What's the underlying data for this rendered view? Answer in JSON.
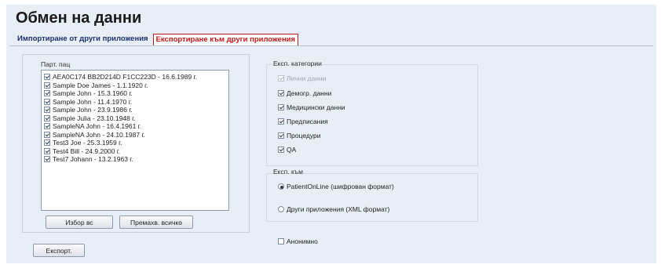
{
  "page_title": "Обмен на данни",
  "tabs": [
    {
      "label": "Импортиране от други приложения",
      "active": false
    },
    {
      "label": "Експортиране към други приложения",
      "active": true
    }
  ],
  "patients": {
    "group_label": "Парт. пац",
    "items": [
      {
        "label": "AEA0C174 BB2D214D F1CC223D - 16.6.1989 г.",
        "checked": true
      },
      {
        "label": "Sample Doe James - 1.1.1920 г.",
        "checked": true
      },
      {
        "label": "Sample John - 15.3.1960 г.",
        "checked": true
      },
      {
        "label": "Sample John - 11.4.1970 г.",
        "checked": true
      },
      {
        "label": "Sample John - 23.9.1986 г.",
        "checked": true
      },
      {
        "label": "Sample Julia - 23.10.1948 г.",
        "checked": true
      },
      {
        "label": "SampleNA John - 16.4.1961 г.",
        "checked": true
      },
      {
        "label": "SampleNA John - 24.10.1987 г.",
        "checked": true
      },
      {
        "label": "Test3 Joe - 25.3.1959 г.",
        "checked": true
      },
      {
        "label": "Test4 Bill - 24.9.2000 г.",
        "checked": true
      },
      {
        "label": "Test7 Johann - 13.2.1963 г.",
        "checked": true
      }
    ],
    "select_all_label": "Избор вс",
    "deselect_all_label": "Премахв. всичко"
  },
  "export_button_label": "Експорт.",
  "categories": {
    "group_label": "Експ. категории",
    "items": [
      {
        "label": "Лични данни",
        "checked": true,
        "disabled": true
      },
      {
        "label": "Демогр. данни",
        "checked": true,
        "disabled": false
      },
      {
        "label": "Медицински данни",
        "checked": true,
        "disabled": false
      },
      {
        "label": "Предписания",
        "checked": true,
        "disabled": false
      },
      {
        "label": "Процедури",
        "checked": true,
        "disabled": false
      },
      {
        "label": "QA",
        "checked": true,
        "disabled": false
      }
    ]
  },
  "export_to": {
    "group_label": "Експ. към",
    "options": [
      {
        "label": "PatientOnLine (шифрован формат)",
        "selected": true
      },
      {
        "label": "Други приложения (XML формат)",
        "selected": false
      }
    ]
  },
  "anonymous": {
    "label": "Анонимно",
    "checked": false
  },
  "colors": {
    "background": "#e8eef6",
    "active_tab": "#c21818",
    "inactive_tab": "#1a2f70"
  }
}
